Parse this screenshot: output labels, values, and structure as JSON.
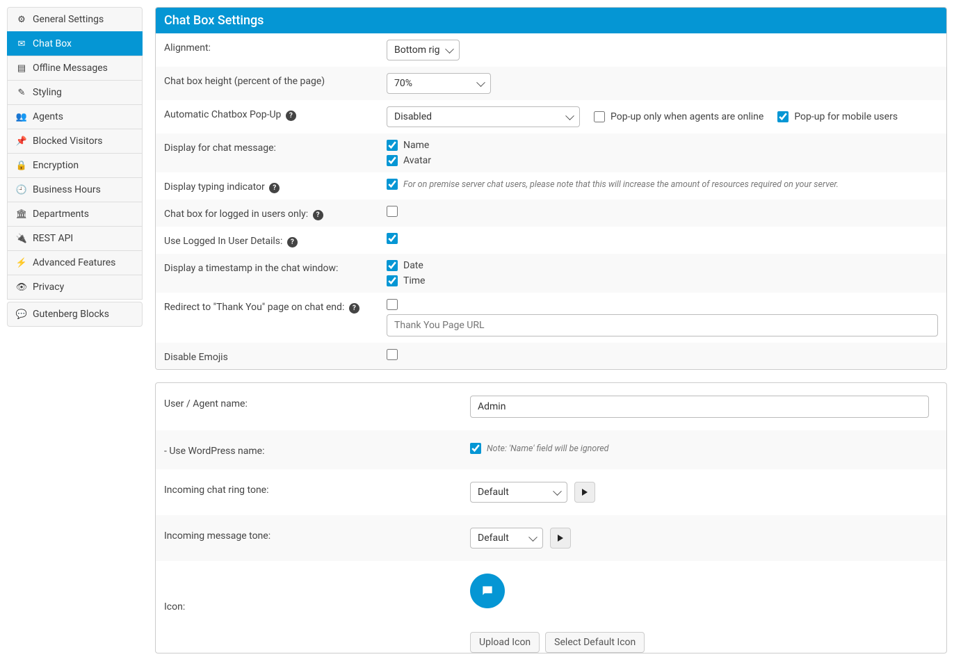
{
  "sidebar": {
    "items": [
      {
        "label": "General Settings"
      },
      {
        "label": "Chat Box"
      },
      {
        "label": "Offline Messages"
      },
      {
        "label": "Styling"
      },
      {
        "label": "Agents"
      },
      {
        "label": "Blocked Visitors"
      },
      {
        "label": "Encryption"
      },
      {
        "label": "Business Hours"
      },
      {
        "label": "Departments"
      },
      {
        "label": "REST API"
      },
      {
        "label": "Advanced Features"
      },
      {
        "label": "Privacy"
      },
      {
        "label": "Gutenberg Blocks"
      }
    ]
  },
  "header": {
    "title": "Chat Box Settings"
  },
  "settings": {
    "alignment": {
      "label": "Alignment:",
      "value": "Bottom right"
    },
    "height": {
      "label": "Chat box height (percent of the page)",
      "value": "70%"
    },
    "autopopup": {
      "label": "Automatic Chatbox Pop-Up",
      "value": "Disabled",
      "popup_online_label": "Pop-up only when agents are online",
      "popup_mobile_label": "Pop-up for mobile users"
    },
    "display_msg": {
      "label": "Display for chat message:",
      "opt_name": "Name",
      "opt_avatar": "Avatar"
    },
    "typing": {
      "label": "Display typing indicator",
      "hint": "For on premise server chat users, please note that this will increase the amount of resources required on your server."
    },
    "loggedin_only": {
      "label": "Chat box for logged in users only:"
    },
    "use_logged": {
      "label": "Use Logged In User Details:"
    },
    "timestamp": {
      "label": "Display a timestamp in the chat window:",
      "opt_date": "Date",
      "opt_time": "Time"
    },
    "redirect": {
      "label": "Redirect to \"Thank You\" page on chat end:",
      "placeholder": "Thank You Page URL"
    },
    "disable_emojis": {
      "label": "Disable Emojis"
    }
  },
  "agent": {
    "name": {
      "label": "User / Agent name:",
      "value": "Admin"
    },
    "use_wp": {
      "label": "- Use WordPress name:",
      "hint": "Note: 'Name' field will be ignored"
    },
    "ring": {
      "label": "Incoming chat ring tone:",
      "value": "Default"
    },
    "msg_tone": {
      "label": "Incoming message tone:",
      "value": "Default"
    },
    "icon": {
      "label": "Icon:",
      "upload": "Upload Icon",
      "default": "Select Default Icon"
    }
  }
}
